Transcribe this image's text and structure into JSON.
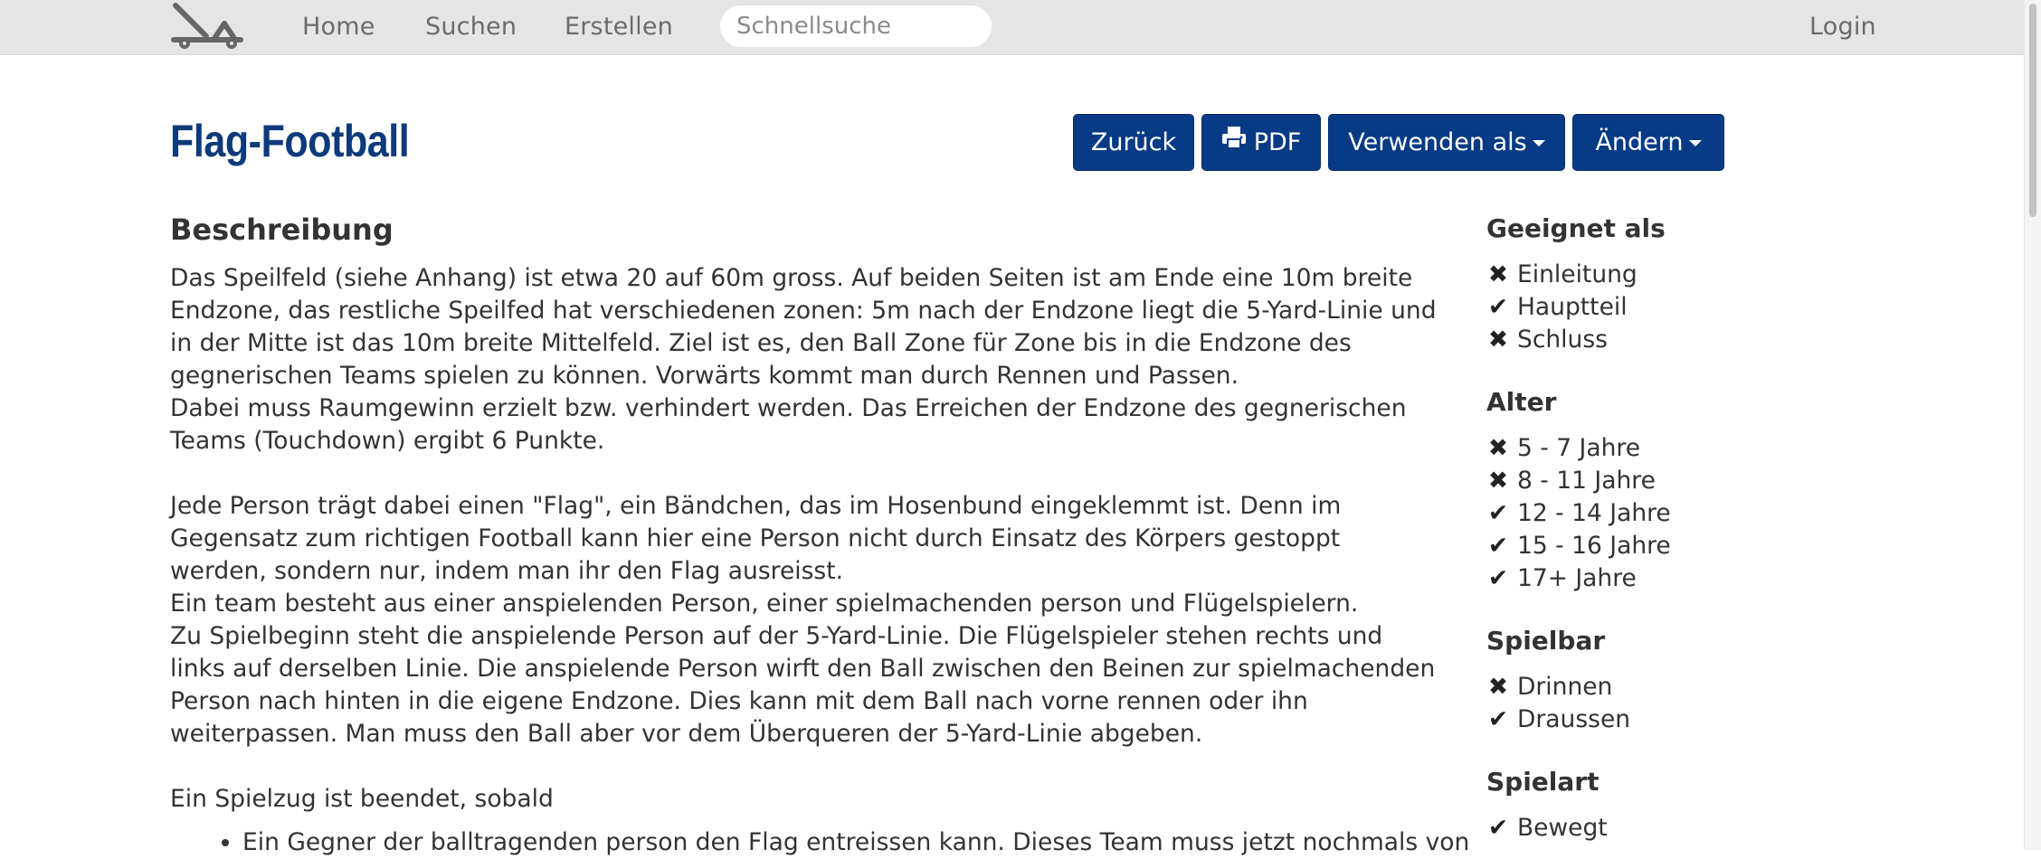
{
  "navbar": {
    "logo_icon": "catapult-icon",
    "links": [
      "Home",
      "Suchen",
      "Erstellen"
    ],
    "search_placeholder": "Schnellsuche",
    "login_label": "Login"
  },
  "page": {
    "title": "Flag-Football",
    "buttons": {
      "back": "Zurück",
      "pdf": "PDF",
      "use_as": "Verwenden als",
      "edit": "Ändern"
    },
    "accent_color": "#083b85"
  },
  "description": {
    "heading": "Beschreibung",
    "paragraphs": [
      "Das Speilfeld (siehe Anhang) ist etwa 20 auf 60m gross. Auf beiden Seiten ist am Ende eine 10m breite Endzone, das restliche Speilfed hat verschiedenen zonen: 5m nach der Endzone liegt die 5-Yard-Linie und in der Mitte ist das 10m breite Mittelfeld. Ziel ist es, den Ball Zone für Zone bis in die Endzone des gegnerischen Teams spielen zu können. Vorwärts kommt man durch Rennen und Passen.",
      "Dabei muss Raumgewinn erzielt bzw. verhindert werden. Das Erreichen der Endzone des gegnerischen Teams (Touchdown) ergibt 6 Punkte.",
      "Jede Person trägt dabei einen \"Flag\", ein Bändchen, das im Hosenbund eingeklemmt ist. Denn im Gegensatz zum richtigen Football kann hier eine Person nicht durch Einsatz des Körpers gestoppt werden, sondern nur, indem man ihr den Flag ausreisst.",
      "Ein team besteht aus einer anspielenden Person, einer spielmachenden person und Flügelspielern.",
      "Zu Spielbeginn steht die anspielende Person auf der 5-Yard-Linie. Die Flügelspieler stehen rechts und links auf derselben Linie. Die anspielende Person wirft den Ball zwischen den Beinen zur spielmachenden Person nach hinten in die eigene Endzone. Dies kann mit dem Ball nach vorne rennen oder ihn weiterpassen. Man muss den Ball aber vor dem Überqueren der 5-Yard-Linie abgeben.",
      "Ein Spielzug ist beendet, sobald"
    ],
    "bullets": [
      "Ein Gegner der balltragenden person den Flag entreissen kann. Dieses Team muss jetzt nochmals von"
    ]
  },
  "sidebar": {
    "suitable": {
      "heading": "Geeignet als",
      "items": [
        {
          "label": "Einleitung",
          "mark": "✖",
          "icon": "cross-icon"
        },
        {
          "label": "Hauptteil",
          "mark": "✔",
          "icon": "check-icon"
        },
        {
          "label": "Schluss",
          "mark": "✖",
          "icon": "cross-icon"
        }
      ]
    },
    "age": {
      "heading": "Alter",
      "items": [
        {
          "label": "5 - 7 Jahre",
          "mark": "✖",
          "icon": "cross-icon"
        },
        {
          "label": "8 - 11 Jahre",
          "mark": "✖",
          "icon": "cross-icon"
        },
        {
          "label": "12 - 14 Jahre",
          "mark": "✔",
          "icon": "check-icon"
        },
        {
          "label": "15 - 16 Jahre",
          "mark": "✔",
          "icon": "check-icon"
        },
        {
          "label": "17+ Jahre",
          "mark": "✔",
          "icon": "check-icon"
        }
      ]
    },
    "playable": {
      "heading": "Spielbar",
      "items": [
        {
          "label": "Drinnen",
          "mark": "✖",
          "icon": "cross-icon"
        },
        {
          "label": "Draussen",
          "mark": "✔",
          "icon": "check-icon"
        }
      ]
    },
    "game_type": {
      "heading": "Spielart",
      "items": [
        {
          "label": "Bewegt",
          "mark": "✔",
          "icon": "check-icon"
        }
      ]
    }
  }
}
